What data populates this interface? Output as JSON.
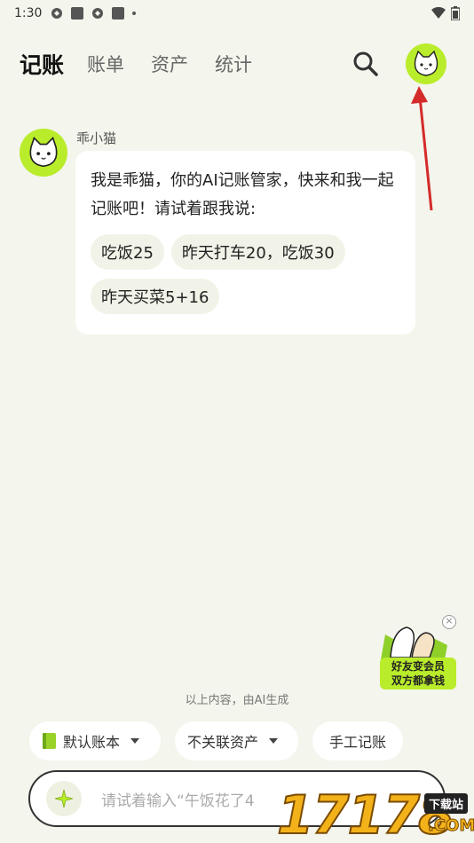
{
  "status_bar": {
    "time": "1:30"
  },
  "header": {
    "tabs": [
      {
        "label": "记账",
        "active": true
      },
      {
        "label": "账单",
        "active": false
      },
      {
        "label": "资产",
        "active": false
      },
      {
        "label": "统计",
        "active": false
      }
    ],
    "search_icon": "search-icon",
    "avatar_icon": "cat-avatar-icon"
  },
  "chat": {
    "sender": "乖小猫",
    "message": "我是乖猫，你的AI记账管家，快来和我一起记账吧！请试着跟我说:",
    "suggestions": [
      "吃饭25",
      "昨天打车20，吃饭30",
      "昨天买菜5+16"
    ]
  },
  "promo": {
    "line1": "好友变会员",
    "line2": "双方都拿钱"
  },
  "disclaimer": "以上内容，由AI生成",
  "quick_actions": {
    "ledger": "默认账本",
    "asset": "不关联资产",
    "manual": "手工记账"
  },
  "input": {
    "placeholder": "请试着输入“午饭花了4"
  },
  "watermark": {
    "digits": "17178",
    "badge": "下载站",
    "domain": ".COM"
  },
  "colors": {
    "accent": "#b9ec2a",
    "background": "#f4f5ec",
    "arrow": "#d42a2a"
  }
}
